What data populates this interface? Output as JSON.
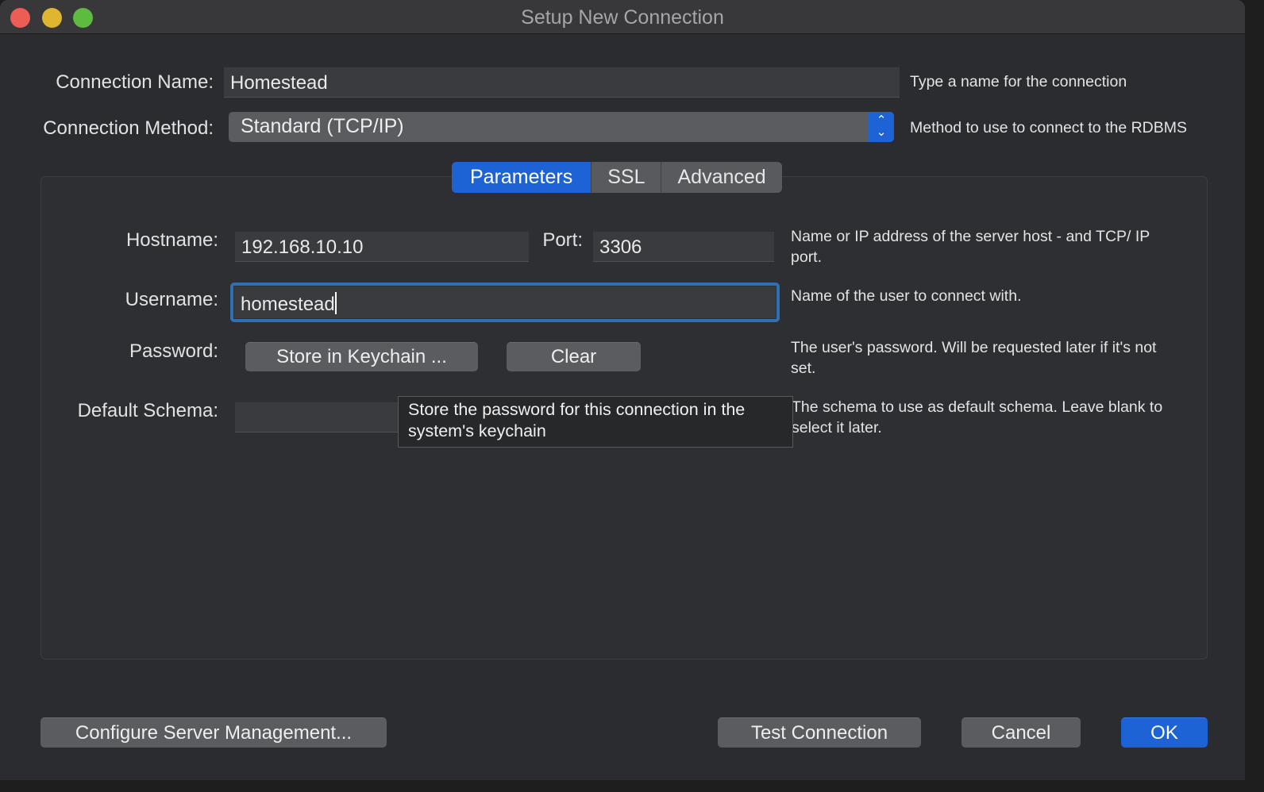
{
  "window": {
    "title": "Setup New Connection"
  },
  "connection_name": {
    "label": "Connection Name:",
    "value": "Homestead",
    "hint": "Type a name for the connection"
  },
  "connection_method": {
    "label": "Connection Method:",
    "value": "Standard (TCP/IP)",
    "hint": "Method to use to connect to the RDBMS"
  },
  "tabs": [
    {
      "label": "Parameters",
      "active": true
    },
    {
      "label": "SSL",
      "active": false
    },
    {
      "label": "Advanced",
      "active": false
    }
  ],
  "parameters": {
    "hostname": {
      "label": "Hostname:",
      "value": "192.168.10.10"
    },
    "port": {
      "label": "Port:",
      "value": "3306"
    },
    "host_hint": "Name or IP address of the server host - and TCP/ IP port.",
    "username": {
      "label": "Username:",
      "value": "homestead",
      "hint": "Name of the user to connect with."
    },
    "password": {
      "label": "Password:",
      "store_button": "Store in Keychain ...",
      "clear_button": "Clear",
      "hint": "The user's password. Will be requested later if it's not set."
    },
    "default_schema": {
      "label": "Default Schema:",
      "value": "",
      "hint": "The schema to use as default schema. Leave blank to select it later."
    }
  },
  "tooltip": "Store the password for this connection in the system's keychain",
  "footer": {
    "configure_button": "Configure Server Management...",
    "test_button": "Test Connection",
    "cancel_button": "Cancel",
    "ok_button": "OK"
  },
  "colors": {
    "accent": "#1e63d6",
    "window_bg": "#2b2c2f",
    "close": "#ec5e55",
    "minimize": "#e0b52f",
    "maximize": "#5dbb40"
  }
}
